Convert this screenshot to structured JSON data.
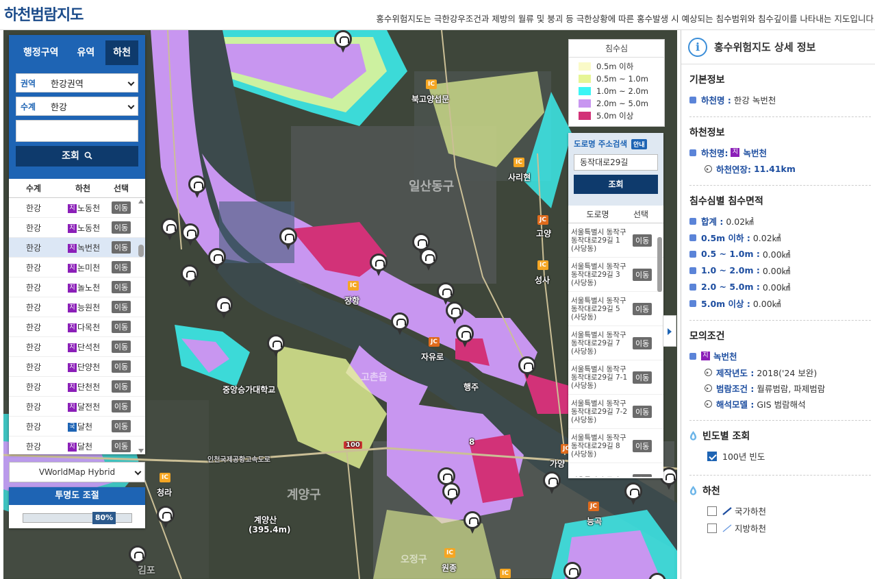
{
  "header": {
    "title": "하천범람지도",
    "description": "홍수위험지도는 극한강우조건과 제방의 월류 및 붕괴 등 극한상황에 따른 홍수발생 시 예상되는 침수범위와 침수깊이를 나타내는 지도입니다"
  },
  "left_panel": {
    "tabs": [
      "행정구역",
      "유역",
      "하천"
    ],
    "active_tab": "하천",
    "region_label": "권역",
    "region_value": "한강권역",
    "system_label": "수계",
    "system_value": "한강",
    "search_button": "조회",
    "columns": [
      "수계",
      "하천",
      "선택"
    ],
    "rows": [
      {
        "system": "한강",
        "tag": "지",
        "river": "노동천",
        "action": "이동"
      },
      {
        "system": "한강",
        "tag": "지",
        "river": "노동천",
        "action": "이동"
      },
      {
        "system": "한강",
        "tag": "지",
        "river": "녹번천",
        "action": "이동",
        "selected": true
      },
      {
        "system": "한강",
        "tag": "지",
        "river": "논미천",
        "action": "이동"
      },
      {
        "system": "한강",
        "tag": "지",
        "river": "놀노천",
        "action": "이동"
      },
      {
        "system": "한강",
        "tag": "지",
        "river": "능원천",
        "action": "이동"
      },
      {
        "system": "한강",
        "tag": "지",
        "river": "다목천",
        "action": "이동"
      },
      {
        "system": "한강",
        "tag": "지",
        "river": "단석천",
        "action": "이동"
      },
      {
        "system": "한강",
        "tag": "지",
        "river": "단양천",
        "action": "이동"
      },
      {
        "system": "한강",
        "tag": "지",
        "river": "단천천",
        "action": "이동"
      },
      {
        "system": "한강",
        "tag": "지",
        "river": "달전천",
        "action": "이동"
      },
      {
        "system": "한강",
        "tag": "국",
        "river": "달천",
        "action": "이동"
      },
      {
        "system": "한강",
        "tag": "지",
        "river": "달천",
        "action": "이동"
      }
    ]
  },
  "basemap": {
    "selected": "VWorldMap Hybrid"
  },
  "opacity": {
    "title": "투명도 조절",
    "value": 80,
    "value_label": "80%"
  },
  "legend": {
    "title": "침수심",
    "items": [
      {
        "label": "0.5m 이하",
        "color": "#fafac8"
      },
      {
        "label": "0.5m ~ 1.0m",
        "color": "#e6f596"
      },
      {
        "label": "1.0m ~ 2.0m",
        "color": "#3cf5f5"
      },
      {
        "label": "2.0m ~ 5.0m",
        "color": "#c896f0"
      },
      {
        "label": "5.0m 이상",
        "color": "#d23278"
      }
    ]
  },
  "address_search": {
    "title": "도로명 주소검색",
    "badge": "안내",
    "input_value": "동작대로29길",
    "button": "조회",
    "columns": [
      "도로명",
      "선택"
    ],
    "rows": [
      {
        "address": "서울특별시 동작구 동작대로29길 1 (사당동)",
        "action": "이동"
      },
      {
        "address": "서울특별시 동작구 동작대로29길 3 (사당동)",
        "action": "이동"
      },
      {
        "address": "서울특별시 동작구 동작대로29길 5 (사당동)",
        "action": "이동"
      },
      {
        "address": "서울특별시 동작구 동작대로29길 7 (사당동)",
        "action": "이동"
      },
      {
        "address": "서울특별시 동작구 동작대로29길 7-1 (사당동)",
        "action": "이동"
      },
      {
        "address": "서울특별시 동작구 동작대로29길 7-2 (사당동)",
        "action": "이동"
      },
      {
        "address": "서울특별시 동작구 동작대로29길 8 (사당동)",
        "action": "이동"
      },
      {
        "address": "서울특별시 동작구",
        "action": "이동"
      }
    ]
  },
  "map_labels": {
    "bukgoyang": "북고양섭문",
    "sariwon": "사리현",
    "ilsan": "일산동구",
    "goyang": "고양",
    "seongsa": "성사",
    "janghang": "장항",
    "jayuro": "자유로",
    "jungang_univ": "중앙승가대학교",
    "gochon": "고촌읍",
    "haengju": "행주",
    "gayang": "가양",
    "cheongna": "청라",
    "gyeyang_gu": "계양구",
    "gyeyangsan": "계양산",
    "gyeyangsan_height": "(395.4m)",
    "ojeong": "오정구",
    "wonjong": "원종",
    "nondong": "능곡",
    "gimpo": "김포",
    "n100": "100",
    "n8": "8",
    "incheon_road": "인천국제공항고속도로",
    "ic": "IC",
    "jc": "JC"
  },
  "detail": {
    "title": "홍수위험지도 상세 정보",
    "basic": {
      "title": "기본정보",
      "key": "하천명 :",
      "value": "한강 녹번천"
    },
    "river": {
      "title": "하천정보",
      "name_key": "하천명:",
      "name_tag": "지",
      "name_value": "녹번천",
      "length_key": "하천연장:",
      "length_value": "11.41km"
    },
    "area": {
      "title": "침수심별 침수면적",
      "items": [
        {
          "key": "합계 :",
          "value": "0.02㎢"
        },
        {
          "key": "0.5m 이하 :",
          "value": "0.02㎢"
        },
        {
          "key": "0.5 ~ 1.0m :",
          "value": "0.00㎢"
        },
        {
          "key": "1.0 ~ 2.0m :",
          "value": "0.00㎢"
        },
        {
          "key": "2.0 ~ 5.0m :",
          "value": "0.00㎢"
        },
        {
          "key": "5.0m 이상 :",
          "value": "0.00㎢"
        }
      ]
    },
    "sim": {
      "title": "모의조건",
      "tag": "지",
      "river": "녹번천",
      "year_key": "제작년도 :",
      "year_value": "2018('24 보완)",
      "cond_key": "범람조건 :",
      "cond_value": "월류범람, 파제범람",
      "model_key": "해석모델 :",
      "model_value": "GIS 범람해석"
    },
    "freq": {
      "title": "빈도별 조회",
      "option": "100년 빈도",
      "checked": true
    },
    "stream": {
      "title": "하천",
      "national": "국가하천",
      "local": "지방하천"
    }
  }
}
